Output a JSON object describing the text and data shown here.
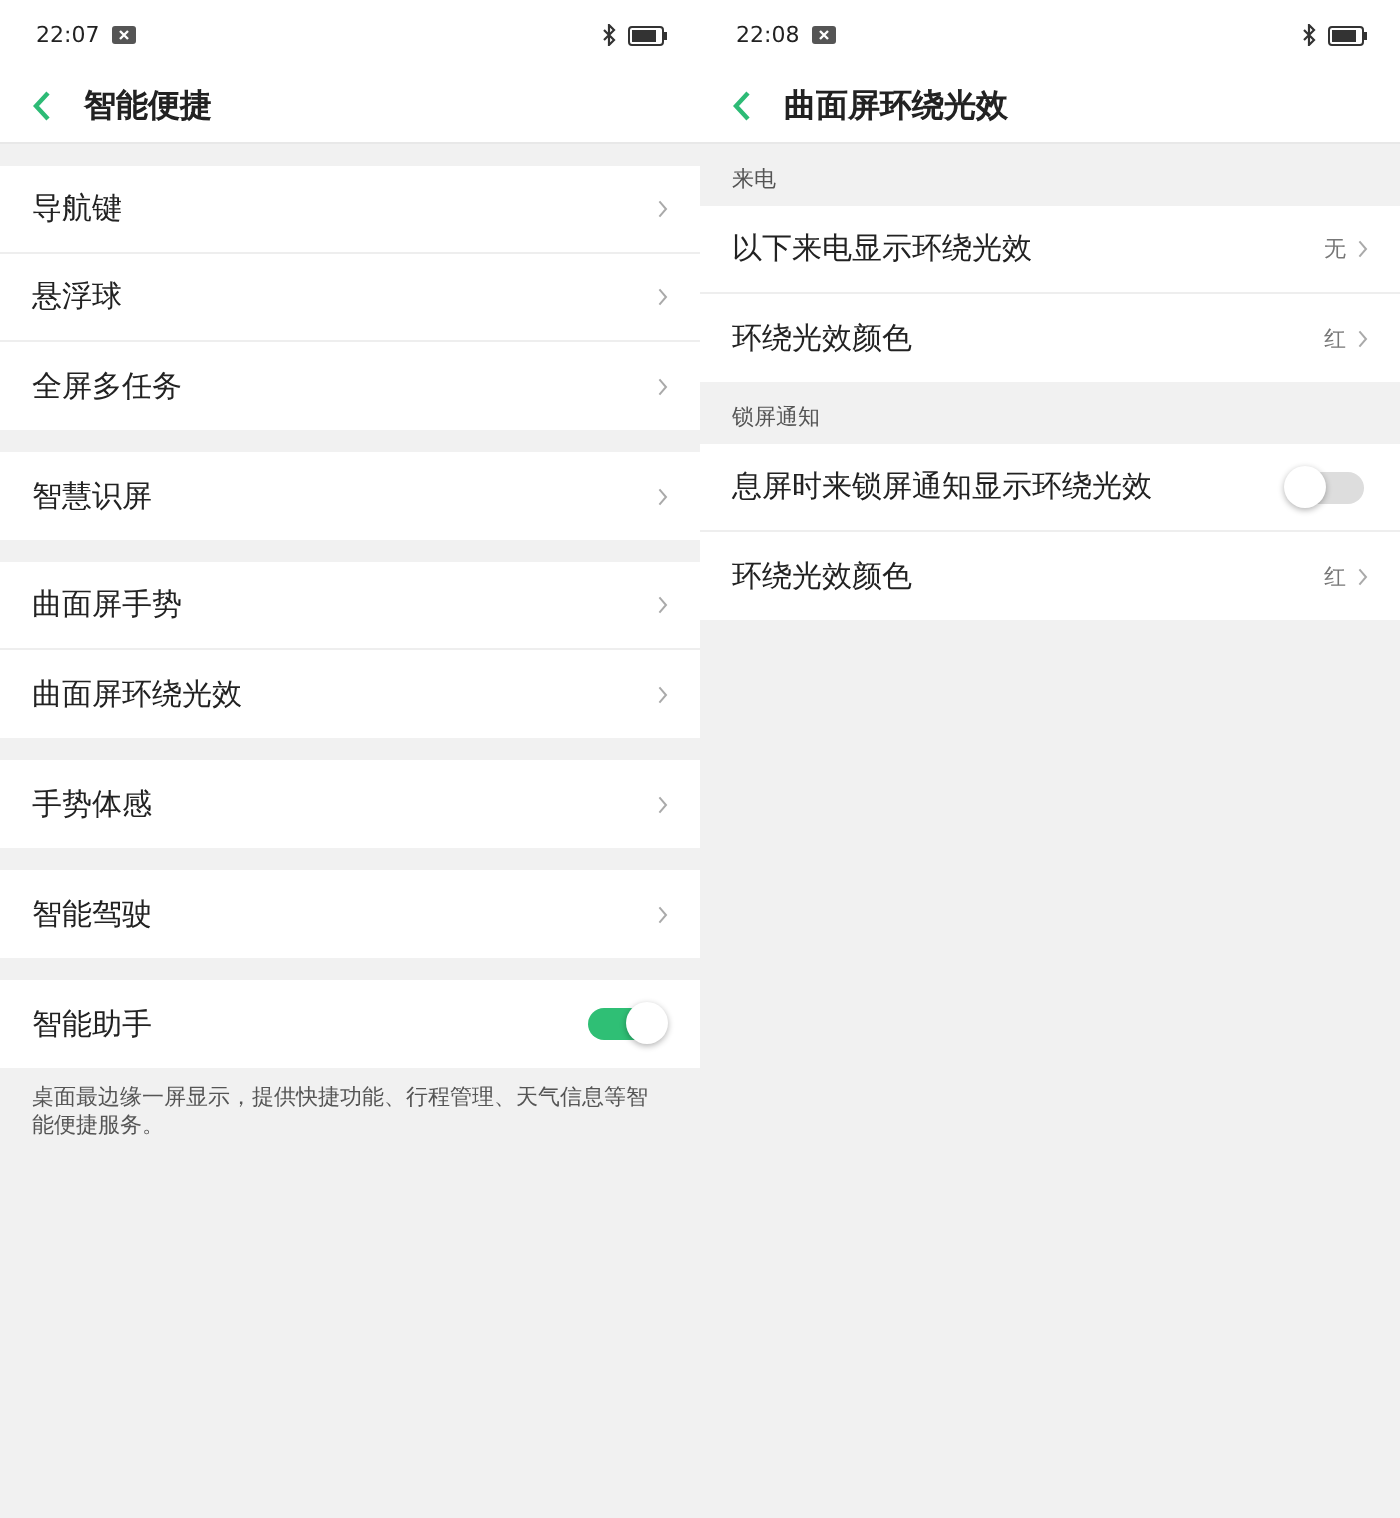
{
  "screens": [
    {
      "status_bar": {
        "time": "22:07"
      },
      "title": "智能便捷",
      "groups": [
        {
          "items": [
            {
              "kind": "link",
              "label": "导航键"
            },
            {
              "kind": "link",
              "label": "悬浮球"
            },
            {
              "kind": "link",
              "label": "全屏多任务"
            }
          ]
        },
        {
          "items": [
            {
              "kind": "link",
              "label": "智慧识屏"
            }
          ]
        },
        {
          "items": [
            {
              "kind": "link",
              "label": "曲面屏手势"
            },
            {
              "kind": "link",
              "label": "曲面屏环绕光效"
            }
          ]
        },
        {
          "items": [
            {
              "kind": "link",
              "label": "手势体感"
            }
          ]
        },
        {
          "items": [
            {
              "kind": "link",
              "label": "智能驾驶"
            }
          ]
        },
        {
          "items": [
            {
              "kind": "toggle",
              "label": "智能助手",
              "on": true
            }
          ],
          "footnote": "桌面最边缘一屏显示，提供快捷功能、行程管理、天气信息等智能便捷服务。"
        }
      ]
    },
    {
      "status_bar": {
        "time": "22:08"
      },
      "title": "曲面屏环绕光效",
      "groups": [
        {
          "header": "来电",
          "items": [
            {
              "kind": "link",
              "label": "以下来电显示环绕光效",
              "value": "无"
            },
            {
              "kind": "link",
              "label": "环绕光效颜色",
              "value": "红"
            }
          ]
        },
        {
          "header": "锁屏通知",
          "items": [
            {
              "kind": "toggle",
              "label": "息屏时来锁屏通知显示环绕光效",
              "on": false
            },
            {
              "kind": "link",
              "label": "环绕光效颜色",
              "value": "红"
            }
          ]
        }
      ]
    }
  ]
}
